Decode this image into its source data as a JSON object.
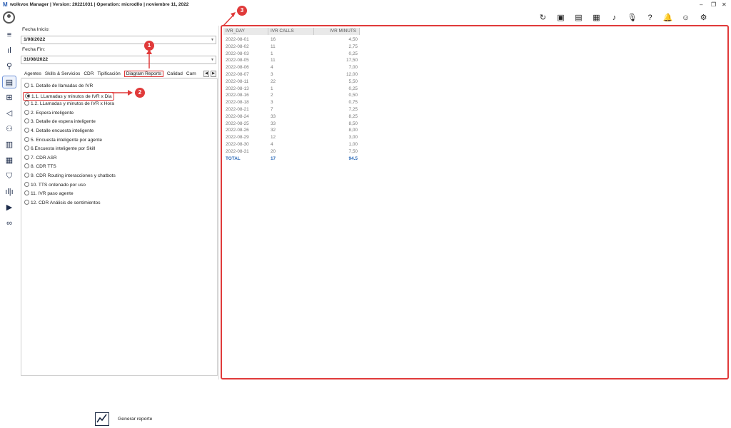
{
  "window": {
    "logo": "M",
    "title": "wolkvox Manager  | Version: 20221031 |  Operation: microdllo | noviembre 11, 2022",
    "minimize": "–",
    "restore": "❐",
    "close": "✕"
  },
  "toolbar": {
    "icons": [
      "refresh-icon",
      "toolbox-icon",
      "book-icon",
      "id-card-icon",
      "music-note-icon",
      "microphone-icon",
      "help-icon",
      "bell-icon",
      "user-circle-icon",
      "settings-icon"
    ],
    "glyphs": [
      "↻",
      "▣",
      "▤",
      "▦",
      "♪",
      "🎙",
      "?",
      "🔔",
      "☺",
      "⚙"
    ]
  },
  "sidebar": {
    "glyphs": [
      "≡",
      "ıl",
      "⚲",
      "▤",
      "⊞",
      "◁",
      "⚇",
      "▥",
      "▦",
      "⛉",
      "ıl|ı",
      "▶",
      "∞"
    ]
  },
  "filters": {
    "fecha_inicio_label": "Fecha Inicio:",
    "fecha_inicio_value": "1/08/2022",
    "fecha_fin_label": "Fecha Fin:",
    "fecha_fin_value": "31/08/2022"
  },
  "tabs": [
    "Agentes",
    "Skills & Servicios",
    "CDR",
    "Tipificación",
    "Diagram Reports",
    "Calidad",
    "Cam"
  ],
  "options": [
    "1. Detalle de llamadas de IVR",
    "1.1. LLamadas y minutos de IVR x Dia",
    "1.2. LLamadas y minutos de IVR x Hora",
    "2. Espera inteligente",
    "3. Detalle de espera inteligente",
    "4. Detalle encuesta inteligente",
    "5. Encuesta inteligente por agente",
    "6.Encuesta inteligente por Skill",
    "7. CDR ASR",
    "8. CDR TTS",
    "9. CDR Routing interacciones y chatbots",
    "10. TTS ordenado por uso",
    "11. IVR paso agente",
    "12. CDR Análisis de sentimientos"
  ],
  "generate_label": "Generar reporte",
  "grid": {
    "headers": [
      "IVR_DAY",
      "IVR CALLS",
      "IVR MINUTS"
    ],
    "rows": [
      [
        "2022-08-01",
        "16",
        "4,50"
      ],
      [
        "2022-08-02",
        "11",
        "2,75"
      ],
      [
        "2022-08-03",
        "1",
        "0,25"
      ],
      [
        "2022-08-05",
        "11",
        "17,50"
      ],
      [
        "2022-08-06",
        "4",
        "7,00"
      ],
      [
        "2022-08-07",
        "3",
        "12,00"
      ],
      [
        "2022-08-11",
        "22",
        "5,50"
      ],
      [
        "2022-08-13",
        "1",
        "0,25"
      ],
      [
        "2022-08-16",
        "2",
        "0,50"
      ],
      [
        "2022-08-18",
        "3",
        "0,75"
      ],
      [
        "2022-08-21",
        "7",
        "7,25"
      ],
      [
        "2022-08-24",
        "33",
        "8,25"
      ],
      [
        "2022-08-25",
        "33",
        "8,50"
      ],
      [
        "2022-08-26",
        "32",
        "8,00"
      ],
      [
        "2022-08-29",
        "12",
        "3,00"
      ],
      [
        "2022-08-30",
        "4",
        "1,00"
      ],
      [
        "2022-08-31",
        "20",
        "7,50"
      ]
    ],
    "total": [
      "TOTAL",
      "17",
      "94.5"
    ]
  },
  "callouts": [
    "1",
    "2",
    "3"
  ],
  "colors": {
    "highlight": "#e03a3a",
    "total": "#2d6bb8"
  }
}
